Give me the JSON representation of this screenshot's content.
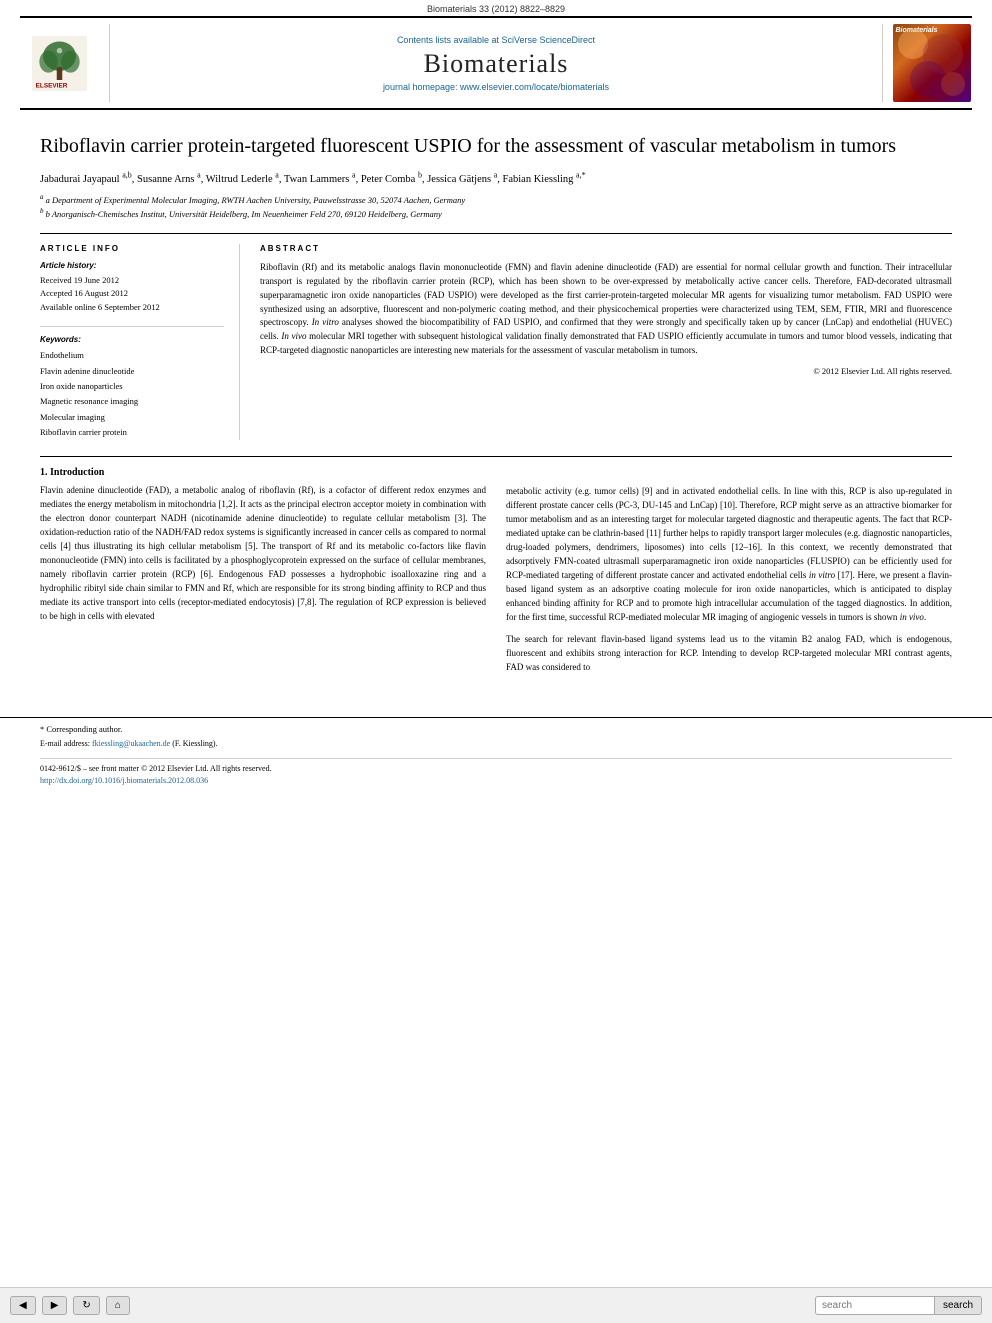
{
  "top_bar": {
    "text": "Biomaterials 33 (2012) 8822–8829"
  },
  "header": {
    "contents_text": "Contents lists available at",
    "contents_link": "SciVerse ScienceDirect",
    "journal_name": "Biomaterials",
    "homepage_text": "journal homepage: www.elsevier.com/locate/biomaterials",
    "elsevier_label": "ELSEVIER",
    "thumb_label": "Biomaterials"
  },
  "article": {
    "title": "Riboflavin carrier protein-targeted fluorescent USPIO for the assessment of vascular metabolism in tumors",
    "authors": "Jabadurai Jayapaul a,b, Susanne Arns a, Wiltrud Lederle a, Twan Lammers a, Peter Comba b, Jessica Gätjens a, Fabian Kiessling a,*",
    "affiliations": [
      "a Department of Experimental Molecular Imaging, RWTH Aachen University, Pauwelsstrasse 30, 52074 Aachen, Germany",
      "b Anorganisch-Chemisches Institut, Universität Heidelberg, Im Neuenheimer Feld 270, 69120 Heidelberg, Germany"
    ],
    "article_info": {
      "heading": "ARTICLE INFO",
      "history_heading": "Article history:",
      "received": "Received 19 June 2012",
      "accepted": "Accepted 16 August 2012",
      "available": "Available online 6 September 2012",
      "keywords_heading": "Keywords:",
      "keywords": [
        "Endothelium",
        "Flavin adenine dinucleotide",
        "Iron oxide nanoparticles",
        "Magnetic resonance imaging",
        "Molecular imaging",
        "Riboflavin carrier protein"
      ]
    },
    "abstract": {
      "heading": "ABSTRACT",
      "text": "Riboflavin (Rf) and its metabolic analogs flavin mononucleotide (FMN) and flavin adenine dinucleotide (FAD) are essential for normal cellular growth and function. Their intracellular transport is regulated by the riboflavin carrier protein (RCP), which has been shown to be over-expressed by metabolically active cancer cells. Therefore, FAD-decorated ultrasmall superparamagnetic iron oxide nanoparticles (FAD USPIO) were developed as the first carrier-protein-targeted molecular MR agents for visualizing tumor metabolism. FAD USPIO were synthesized using an adsorptive, fluorescent and non-polymeric coating method, and their physicochemical properties were characterized using TEM, SEM, FTIR, MRI and fluorescence spectroscopy. In vitro analyses showed the biocompatibility of FAD USPIO, and confirmed that they were strongly and specifically taken up by cancer (LnCap) and endothelial (HUVEC) cells. In vivo molecular MRI together with subsequent histological validation finally demonstrated that FAD USPIO efficiently accumulate in tumors and tumor blood vessels, indicating that RCP-targeted diagnostic nanoparticles are interesting new materials for the assessment of vascular metabolism in tumors.",
      "copyright": "© 2012 Elsevier Ltd. All rights reserved."
    },
    "section1": {
      "number": "1.",
      "heading": "Introduction",
      "left_paragraphs": [
        "Flavin adenine dinucleotide (FAD), a metabolic analog of riboflavin (Rf), is a cofactor of different redox enzymes and mediates the energy metabolism in mitochondria [1,2]. It acts as the principal electron acceptor moiety in combination with the electron donor counterpart NADH (nicotinamide adenine dinucleotide) to regulate cellular metabolism [3]. The oxidation-reduction ratio of the NADH/FAD redox systems is significantly increased in cancer cells as compared to normal cells [4] thus illustrating its high cellular metabolism [5]. The transport of Rf and its metabolic co-factors like flavin mononucleotide (FMN) into cells is facilitated by a phosphoglycoprotein expressed on the surface of cellular membranes, namely riboflavin carrier protein (RCP) [6]. Endogenous FAD possesses a hydrophobic isoalloxazine ring and a hydrophilic ribityl side chain similar to FMN and Rf, which are responsible for its strong binding affinity to RCP and thus mediate its active transport into cells (receptor-mediated endocytosis) [7,8]. The regulation of RCP expression is believed to be high in cells with elevated",
        "metabolic activity (e.g. tumor cells) [9] and in activated endothelial cells. In line with this, RCP is also up-regulated in different prostate cancer cells (PC-3, DU-145 and LnCap) [10]. Therefore, RCP might serve as an attractive biomarker for tumor metabolism and as an interesting target for molecular targeted diagnostic and therapeutic agents. The fact that RCP-mediated uptake can be clathrin-based [11] further helps to rapidly transport larger molecules (e.g. diagnostic nanoparticles, drug-loaded polymers, dendrimers, liposomes) into cells [12–16]. In this context, we recently demonstrated that adsorptively FMN-coated ultrasmall superparamagnetic iron oxide nanoparticles (FLUSPIO) can be efficiently used for RCP-mediated targeting of different prostate cancer and activated endothelial cells in vitro [17]. Here, we present a flavin-based ligand system as an adsorptive coating molecule for iron oxide nanoparticles, which is anticipated to display enhanced binding affinity for RCP and to promote high intracellular accumulation of the tagged diagnostics. In addition, for the first time, successful RCP-mediated molecular MR imaging of angiogenic vessels in tumors is shown in vivo.",
        "The search for relevant flavin-based ligand systems lead us to the vitamin B2 analog FAD, which is endogenous, fluorescent and exhibits strong interaction for RCP. Intending to develop RCP-targeted molecular MRI contrast agents, FAD was considered to"
      ]
    },
    "footer": {
      "corresponding_author_note": "* Corresponding author.",
      "email_label": "E-mail address:",
      "email": "fkiessling@ukaachen.de",
      "email_name": "(F. Kiessling).",
      "issn_line": "0142-9612/$ – see front matter © 2012 Elsevier Ltd. All rights reserved.",
      "doi_link": "http://dx.doi.org/10.1016/j.biomaterials.2012.08.036"
    }
  },
  "toolbar": {
    "search_placeholder": "search",
    "search_label": "search"
  }
}
